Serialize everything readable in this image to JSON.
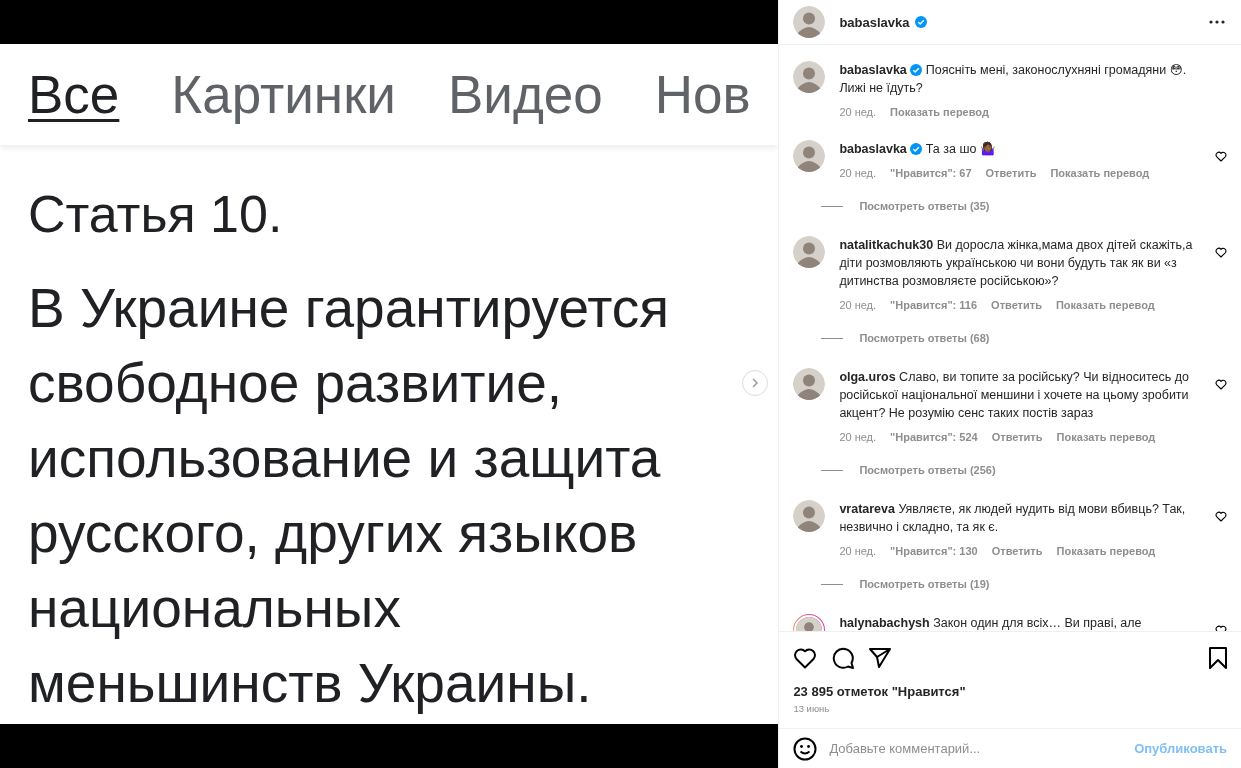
{
  "post_image": {
    "tabs": [
      {
        "label": "Все",
        "selected": true
      },
      {
        "label": "Картинки",
        "selected": false
      },
      {
        "label": "Видео",
        "selected": false
      },
      {
        "label": "Нов",
        "selected": false
      }
    ],
    "heading": "Статья 10.",
    "body": "В Украине гарантируется\nсвободное развитие,\nиспользование и защита\nрусского, других языков\nнациональных\nменьшинств Украины."
  },
  "header": {
    "username": "babaslavka",
    "verified": true
  },
  "comments": [
    {
      "username": "babaslavka",
      "verified": true,
      "story": false,
      "text": "Поясніть мені, законослухняні громадяни 😳. Лижі не їдуть?",
      "time": "20 нед.",
      "translate": "Показать перевод"
    },
    {
      "username": "babaslavka",
      "verified": true,
      "story": false,
      "text": "Та за шо 🤷🏾‍♀️",
      "time": "20 нед.",
      "likes": "\"Нравится\": 67",
      "reply": "Ответить",
      "translate": "Показать перевод",
      "replies": "Посмотреть ответы (35)"
    },
    {
      "username": "natalitkachuk30",
      "verified": false,
      "story": false,
      "text": "Ви доросла жінка,мама двох дітей скажіть,а діти розмовляють українською чи вони будуть так як ви «з дитинства розмовляєте російською»?",
      "time": "20 нед.",
      "likes": "\"Нравится\": 116",
      "reply": "Ответить",
      "translate": "Показать перевод",
      "replies": "Посмотреть ответы (68)"
    },
    {
      "username": "olga.uros",
      "verified": false,
      "story": false,
      "text": "Славо, ви топите за російську? Чи відноситесь до російської національної меншини і хочете на цьому зробити акцент? Не розумію сенс таких постів зараз",
      "time": "20 нед.",
      "likes": "\"Нравится\": 524",
      "reply": "Ответить",
      "translate": "Показать перевод",
      "replies": "Посмотреть ответы (256)"
    },
    {
      "username": "vratareva",
      "verified": false,
      "story": false,
      "text": "Уявляєте, як людей нудить від мови вбивць? Так, незвично і складно, та як є.",
      "time": "20 нед.",
      "likes": "\"Нравится\": 130",
      "reply": "Ответить",
      "translate": "Показать перевод",
      "replies": "Посмотреть ответы (19)"
    },
    {
      "username": "halynabachysh",
      "verified": false,
      "story": true,
      "text": "Закон один для всіх… Ви праві, але"
    }
  ],
  "likes_count": "23 895 отметок \"Нравится\"",
  "date": "13 июнь",
  "comment_field": {
    "placeholder": "Добавьте комментарий...",
    "post_button": "Опубликовать",
    "disabled": true
  }
}
